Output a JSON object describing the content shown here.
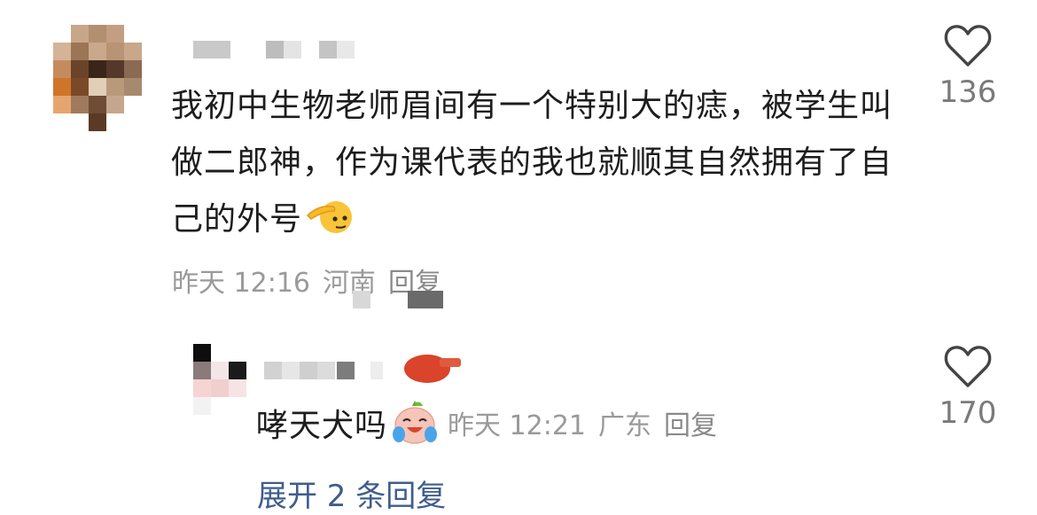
{
  "comment": {
    "text": "我初中生物老师眉间有一个特别大的痣，被学生叫做二郎神，作为课代表的我也就顺其自然拥有了自己的外号",
    "time": "昨天 12:16",
    "location": "河南",
    "reply_label": "回复",
    "like_count": "136",
    "emoji_icon": "saluting-face-icon"
  },
  "reply": {
    "text": "哮天犬吗",
    "time": "昨天 12:21",
    "location": "广东",
    "reply_label": "回复",
    "like_count": "170",
    "emoji_icon": "crying-laughing-face-icon"
  },
  "expand": {
    "label": "展开 2 条回复"
  },
  "colors": {
    "meta_text": "#9a9a9a",
    "like_text": "#7a7a7a",
    "link_text": "#3e5d8c",
    "heart_stroke": "#444444"
  }
}
